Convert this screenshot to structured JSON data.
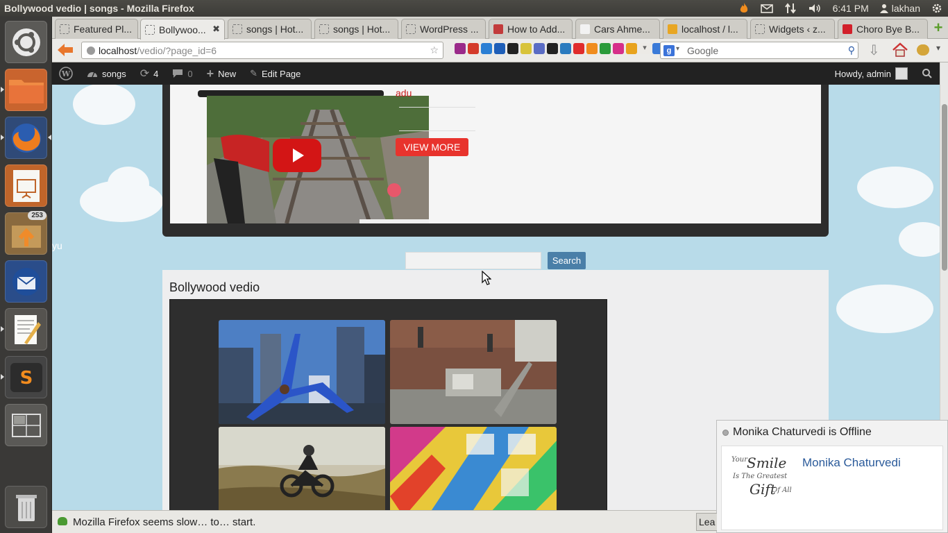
{
  "window": {
    "title": "Bollywood vedio | songs - Mozilla Firefox"
  },
  "panel": {
    "clock": "6:41 PM",
    "user": "lakhan"
  },
  "launcher": {
    "archive_badge": "253"
  },
  "tabs": [
    {
      "label": "Featured Pl..."
    },
    {
      "label": "Bollywoo..."
    },
    {
      "label": "songs | Hot..."
    },
    {
      "label": "songs | Hot..."
    },
    {
      "label": "WordPress ..."
    },
    {
      "label": "How to Add..."
    },
    {
      "label": "Cars Ahme..."
    },
    {
      "label": "localhost / l..."
    },
    {
      "label": "Widgets ‹ z..."
    },
    {
      "label": "Choro Bye B..."
    }
  ],
  "nav": {
    "url_host": "localhost",
    "url_path": "/vedio/?page_id=6",
    "search_placeholder": "Google"
  },
  "adminbar": {
    "site": "songs",
    "updates": "4",
    "comments": "0",
    "new": "New",
    "edit": "Edit Page",
    "howdy": "Howdy, admin"
  },
  "video": {
    "ad_label": "adu",
    "view_more": "VIEW MORE"
  },
  "search": {
    "button": "Search"
  },
  "sidebar_fragment": "yu",
  "gallery": {
    "title": "Bollywood vedio"
  },
  "chat": {
    "status": "Monika Chaturvedi is Offline",
    "name": "Monika Chaturvedi",
    "quote_1": "Your",
    "quote_2": "Smile",
    "quote_3": "Is The Greatest",
    "quote_4": "Gift",
    "quote_5": "Of All"
  },
  "statusbar": {
    "message": "Mozilla Firefox seems slow… to… start.",
    "button": "Lea"
  }
}
